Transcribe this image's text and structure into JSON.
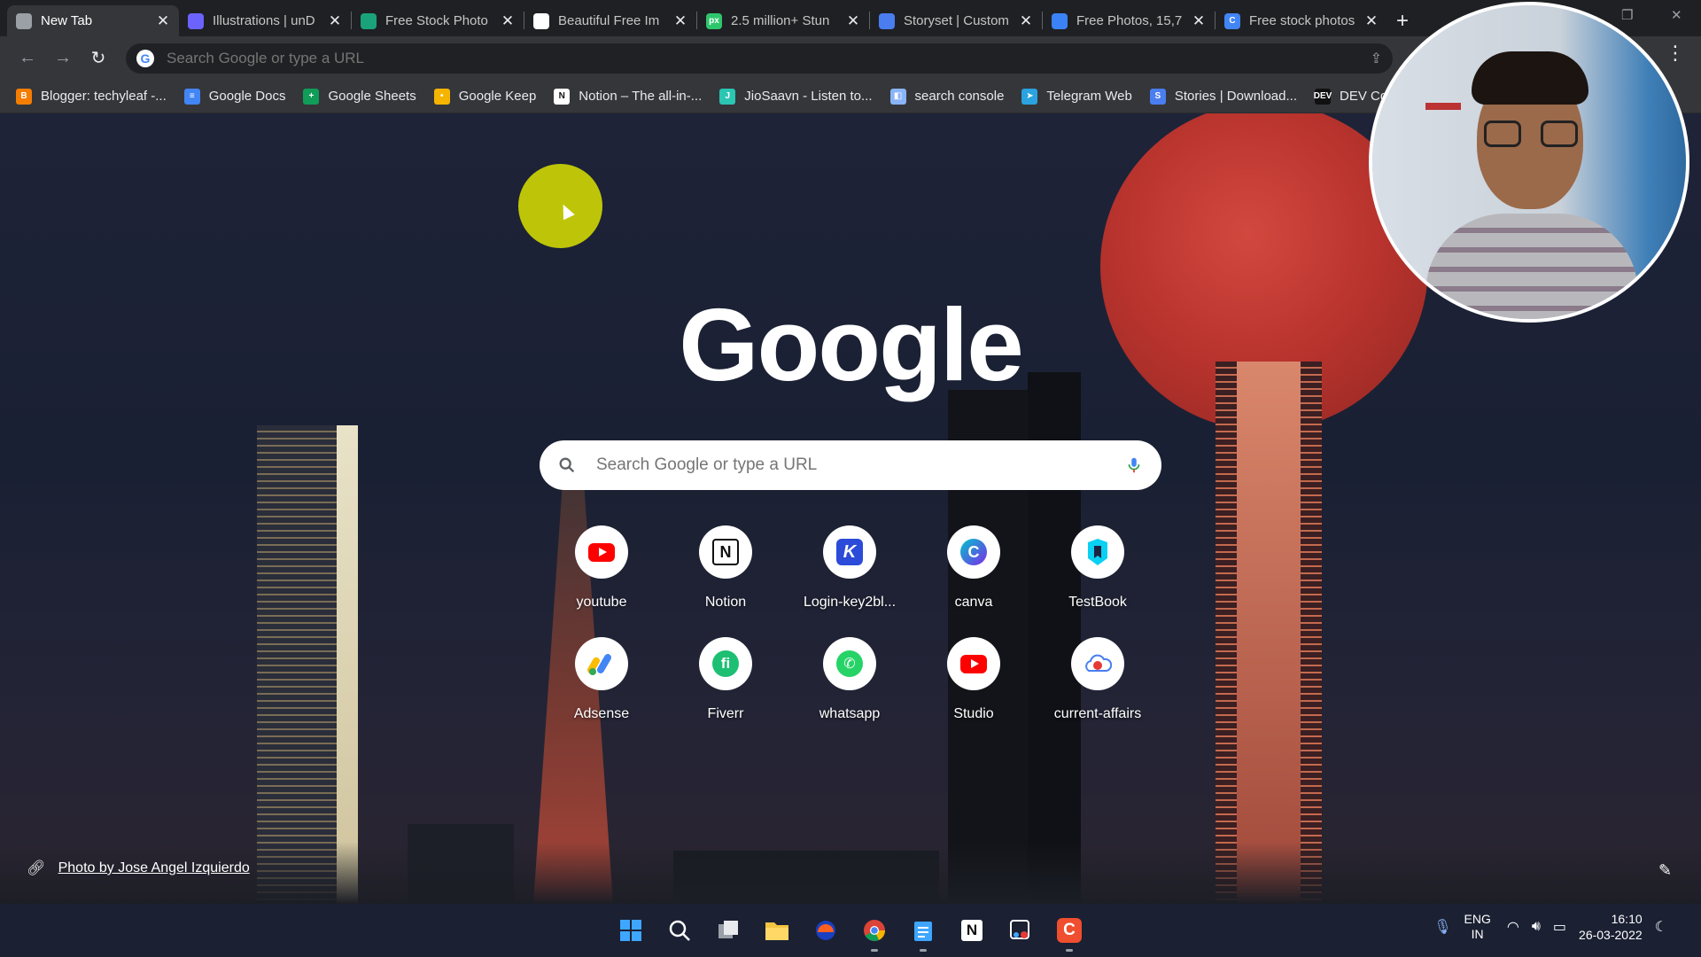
{
  "tabs": [
    {
      "title": "New Tab",
      "favicon": "chrome-icon",
      "color": "#9aa0a6",
      "active": true
    },
    {
      "title": "Illustrations | unD",
      "favicon": "undraw-icon",
      "color": "#6c63ff"
    },
    {
      "title": "Free Stock Photo",
      "favicon": "stock-photo-icon",
      "color": "#1aa37a"
    },
    {
      "title": "Beautiful Free Im",
      "favicon": "unsplash-icon",
      "color": "#ffffff"
    },
    {
      "title": "2.5 million+ Stun",
      "favicon": "pixabay-icon",
      "color": "#2ec66d",
      "badge": "px"
    },
    {
      "title": "Storyset | Custom",
      "favicon": "storyset-icon",
      "color": "#4a7df0"
    },
    {
      "title": "Free Photos, 15,7",
      "favicon": "pexels-icon",
      "color": "#3b82f6"
    },
    {
      "title": "Free stock photos",
      "favicon": "canva-icon",
      "color": "#4285f4",
      "badge": "C"
    }
  ],
  "omnibox": {
    "placeholder": "Search Google or type a URL"
  },
  "bookmarks": [
    {
      "label": "Blogger: techyleaf -...",
      "color": "#f57d00",
      "badge": "B"
    },
    {
      "label": "Google Docs",
      "color": "#4285f4",
      "badge": "≡"
    },
    {
      "label": "Google Sheets",
      "color": "#0f9d58",
      "badge": "+"
    },
    {
      "label": "Google Keep",
      "color": "#f4b400",
      "badge": "•"
    },
    {
      "label": "Notion – The all-in-...",
      "color": "#ffffff",
      "badge": "N"
    },
    {
      "label": "JioSaavn - Listen to...",
      "color": "#2bc5b4",
      "badge": "J"
    },
    {
      "label": "search console",
      "color": "#8ab4f8",
      "badge": "◧"
    },
    {
      "label": "Telegram Web",
      "color": "#2aa3e0",
      "badge": "➤"
    },
    {
      "label": "Stories | Download...",
      "color": "#4a7df0",
      "badge": "S"
    },
    {
      "label": "DEV Co",
      "color": "#111111",
      "badge": "DEV"
    }
  ],
  "logo": "Google",
  "search": {
    "placeholder": "Search Google or type a URL"
  },
  "shortcuts": [
    {
      "label": "youtube",
      "icon": "youtube-icon"
    },
    {
      "label": "Notion",
      "icon": "notion-icon"
    },
    {
      "label": "Login-key2bl...",
      "icon": "key2blog-icon"
    },
    {
      "label": "canva",
      "icon": "canva-icon"
    },
    {
      "label": "TestBook",
      "icon": "testbook-icon"
    },
    {
      "label": "Adsense",
      "icon": "adsense-icon"
    },
    {
      "label": "Fiverr",
      "icon": "fiverr-icon"
    },
    {
      "label": "whatsapp",
      "icon": "whatsapp-icon"
    },
    {
      "label": "Studio",
      "icon": "youtube-studio-icon"
    },
    {
      "label": "current-affairs",
      "icon": "current-affairs-icon"
    }
  ],
  "credit": "Photo by Jose Angel Izquierdo",
  "taskbar": {
    "apps": [
      "windows-start-icon",
      "search-icon",
      "task-view-icon",
      "file-explorer-icon",
      "brave-icon",
      "chrome-icon",
      "notepad-icon",
      "notion-icon",
      "snipping-tool-icon",
      "camtasia-icon"
    ],
    "lang_top": "ENG",
    "lang_bottom": "IN",
    "time": "16:10",
    "date": "26-03-2022"
  }
}
